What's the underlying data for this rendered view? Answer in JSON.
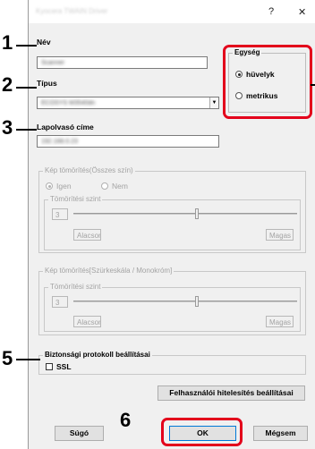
{
  "window": {
    "title": "Kyocera TWAIN Driver",
    "help_glyph": "?",
    "close_glyph": "✕"
  },
  "fields": {
    "name_label": "Név",
    "name_value": "Scanner",
    "type_label": "Típus",
    "type_value": "ECOSYS M3540dn",
    "address_label": "Lapolvasó címe",
    "address_value": "192.168.0.23"
  },
  "unit": {
    "group_label": "Egység",
    "options": [
      "hüvelyk",
      "metrikus"
    ],
    "selected": "hüvelyk"
  },
  "compression_color": {
    "group_label": "Kép tömörítés(Összes szín)",
    "options": [
      "Igen",
      "Nem"
    ],
    "selected": "Igen",
    "level_group_label": "Tömörítési szint",
    "level_value": "3",
    "level_fraction": 0.55,
    "low_label": "Alacsony",
    "high_label": "Magas"
  },
  "compression_gray": {
    "group_label": "Kép tömörítés[Szürkeskála / Monokróm]",
    "level_group_label": "Tömörítési szint",
    "level_value": "3",
    "level_fraction": 0.55,
    "low_label": "Alacsony",
    "high_label": "Magas"
  },
  "security": {
    "group_label": "Biztonsági protokoll beállításai",
    "ssl_label": "SSL",
    "ssl_checked": false
  },
  "buttons": {
    "auth_settings": "Felhasználói hitelesítés beállításai",
    "help": "Súgó",
    "ok": "OK",
    "cancel": "Mégsem"
  },
  "callouts": {
    "name": "1",
    "type": "2",
    "address": "3",
    "security": "5",
    "ok": "6"
  },
  "colors": {
    "highlight": "#e3001b"
  }
}
